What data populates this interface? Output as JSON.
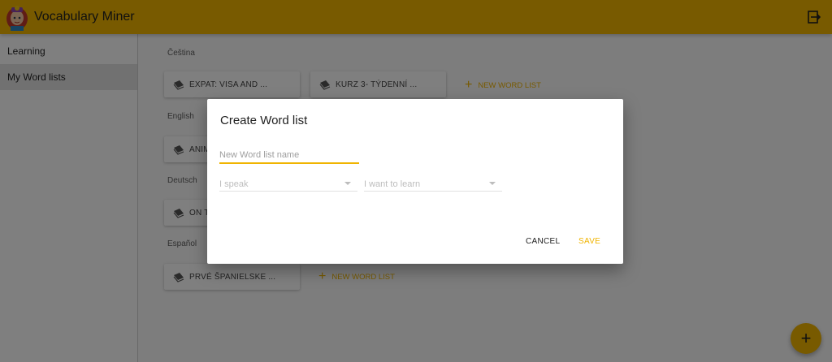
{
  "app": {
    "title": "Vocabulary Miner",
    "logo_icon": "girl-avatar-logo",
    "logout_icon": "logout-icon"
  },
  "colors": {
    "primary": "#f0b400",
    "overlay": "rgba(0,0,0,0.5)"
  },
  "sidebar": {
    "items": [
      {
        "label": "Learning",
        "active": false
      },
      {
        "label": "My Word lists",
        "active": true
      }
    ]
  },
  "main": {
    "groups": [
      {
        "language": "Čeština",
        "lists": [
          "EXPAT: VISA AND ...",
          "KURZ 3- TÝDENNÍ ..."
        ],
        "new_list": "NEW WORD LIST"
      },
      {
        "language": "English",
        "lists": [
          "ANIM"
        ]
      },
      {
        "language": "Deutsch",
        "lists": [
          "ON TI"
        ]
      },
      {
        "language": "Español",
        "lists": [
          "PRVÉ ŠPANIELSKE ..."
        ],
        "new_list": "NEW WORD LIST"
      }
    ]
  },
  "dialog": {
    "title": "Create Word list",
    "name_placeholder": "New Word list name",
    "name_value": "",
    "speak_placeholder": "I speak",
    "learn_placeholder": "I want to learn",
    "cancel_label": "CANCEL",
    "save_label": "SAVE"
  },
  "fab": {
    "label": "+",
    "icon": "add-icon"
  }
}
